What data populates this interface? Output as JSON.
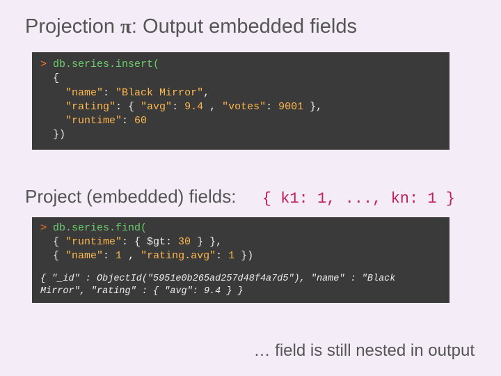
{
  "title_before": "Projection ",
  "title_pi": "π",
  "title_after": ": Output embedded fields",
  "insert": {
    "prompt": ">",
    "cmd": " db.series.insert(",
    "l2": "  {",
    "l3a": "    ",
    "l3b": "\"name\"",
    "l3c": ": ",
    "l3d": "\"Black Mirror\"",
    "l3e": ",",
    "l4a": "    ",
    "l4b": "\"rating\"",
    "l4c": ": { ",
    "l4d": "\"avg\"",
    "l4e": ": ",
    "l4f": "9.4",
    "l4g": " , ",
    "l4h": "\"votes\"",
    "l4i": ": ",
    "l4j": "9001",
    "l4k": " },",
    "l5a": "    ",
    "l5b": "\"runtime\"",
    "l5c": ": ",
    "l5d": "60",
    "l6": "  })"
  },
  "subhead": "Project (embedded) fields:",
  "pattern": "{ k1: 1, ..., kn: 1 }",
  "find": {
    "prompt": ">",
    "cmd": " db.series.find(",
    "l2a": "  { ",
    "l2b": "\"runtime\"",
    "l2c": ": { $gt: ",
    "l2d": "30",
    "l2e": " } },",
    "l3a": "  { ",
    "l3b": "\"name\"",
    "l3c": ": ",
    "l3d": "1",
    "l3e": " , ",
    "l3f": "\"rating.avg\"",
    "l3g": ": ",
    "l3h": "1",
    "l3i": " })"
  },
  "result": "{ \"_id\" : ObjectId(\"5951e0b265ad257d48f4a7d5\"), \"name\" : \"Black Mirror\", \"rating\" : { \"avg\": 9.4 } }",
  "footer": "… field is still nested in output"
}
